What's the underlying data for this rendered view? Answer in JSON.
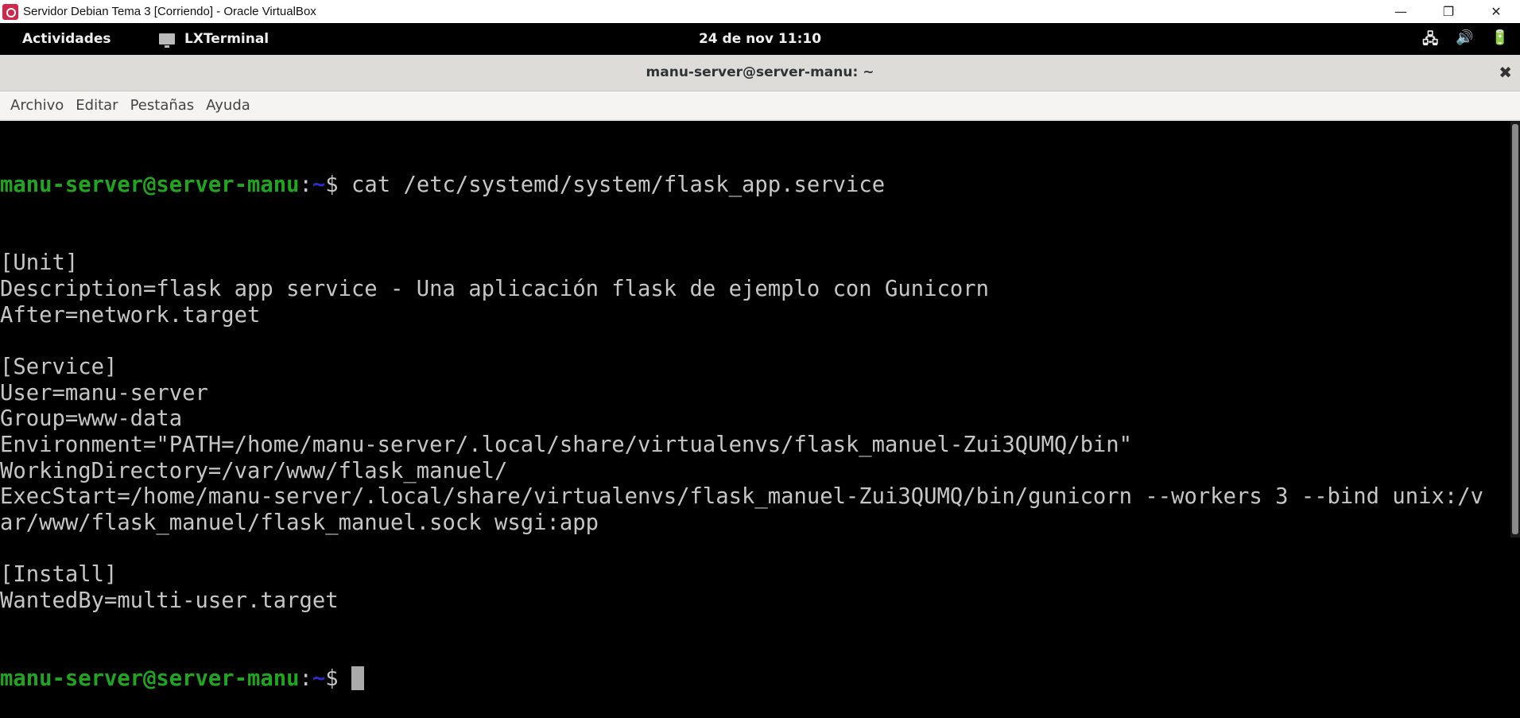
{
  "window": {
    "title": "Servidor Debian Tema 3 [Corriendo] - Oracle VirtualBox",
    "controls": {
      "minimize": "—",
      "restore": "❐",
      "close": "✕"
    }
  },
  "topbar": {
    "activities": "Actividades",
    "app": "LXTerminal",
    "clock": "24 de nov  11:10",
    "tray": {
      "network": "network-icon",
      "volume": "volume-icon",
      "battery": "battery-icon"
    }
  },
  "terminal_window": {
    "title": "manu-server@server-manu: ~",
    "close": "✖"
  },
  "menu": [
    "Archivo",
    "Editar",
    "Pestañas",
    "Ayuda"
  ],
  "terminal": {
    "prompt_user": "manu-server@server-manu",
    "prompt_colon": ":",
    "prompt_path": "~",
    "prompt_sign": "$ ",
    "command": "cat /etc/systemd/system/flask_app.service",
    "output": [
      "[Unit]",
      "Description=flask app service - Una aplicación flask de ejemplo con Gunicorn",
      "After=network.target",
      "",
      "[Service]",
      "User=manu-server",
      "Group=www-data",
      "Environment=\"PATH=/home/manu-server/.local/share/virtualenvs/flask_manuel-Zui3QUMQ/bin\"",
      "WorkingDirectory=/var/www/flask_manuel/",
      "ExecStart=/home/manu-server/.local/share/virtualenvs/flask_manuel-Zui3QUMQ/bin/gunicorn --workers 3 --bind unix:/v",
      "ar/www/flask_manuel/flask_manuel.sock wsgi:app",
      "",
      "[Install]",
      "WantedBy=multi-user.target"
    ]
  }
}
